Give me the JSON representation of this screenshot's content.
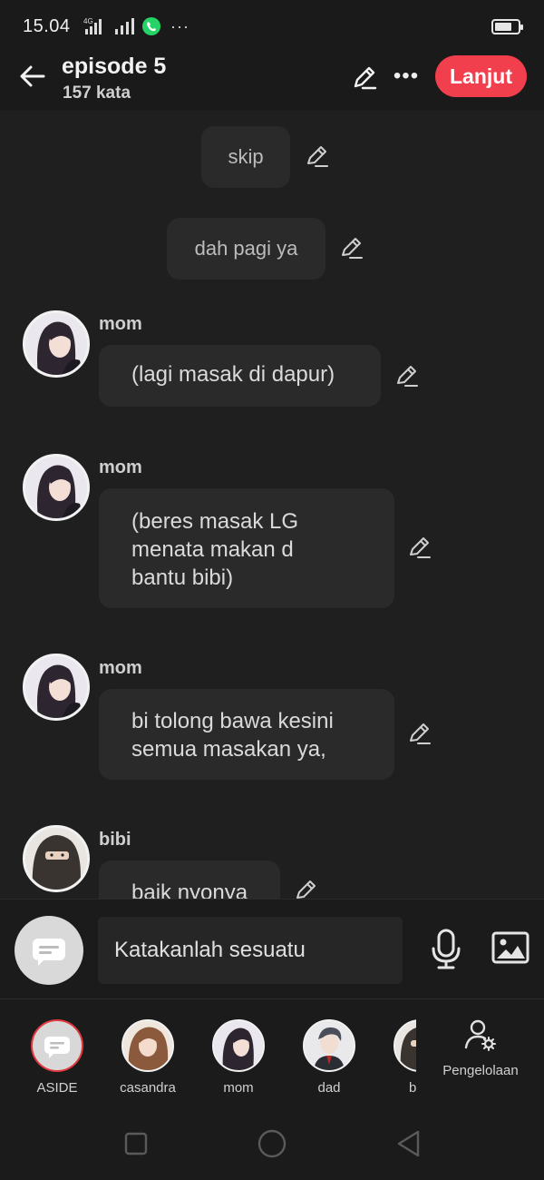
{
  "status_bar": {
    "time": "15.04",
    "network": "4G",
    "icons": [
      "signal-4g-icon",
      "signal-icon",
      "whatsapp-icon",
      "more-dots-icon",
      "battery-icon"
    ],
    "battery_level": 0.75
  },
  "header": {
    "title": "episode 5",
    "subtitle": "157 kata",
    "next_label": "Lanjut",
    "accent": "#f23f4d"
  },
  "chat": {
    "narrations": [
      {
        "text": "skip"
      },
      {
        "text": "dah pagi ya"
      }
    ],
    "messages": [
      {
        "speaker": "mom",
        "text": "(lagi masak di dapur)"
      },
      {
        "speaker": "mom",
        "lines": [
          "(beres masak LG",
          "menata makan d",
          "bantu bibi)"
        ]
      },
      {
        "speaker": "mom",
        "lines": [
          "bi tolong bawa kesini",
          "semua masakan ya,"
        ]
      },
      {
        "speaker": "bibi",
        "text": "baik nyonya"
      }
    ]
  },
  "composer": {
    "placeholder": "Katakanlah sesuatu"
  },
  "characters": [
    {
      "name": "ASIDE",
      "selected": true
    },
    {
      "name": "casandra"
    },
    {
      "name": "mom"
    },
    {
      "name": "dad"
    },
    {
      "name": "b"
    }
  ],
  "manage_label": "Pengelolaan"
}
